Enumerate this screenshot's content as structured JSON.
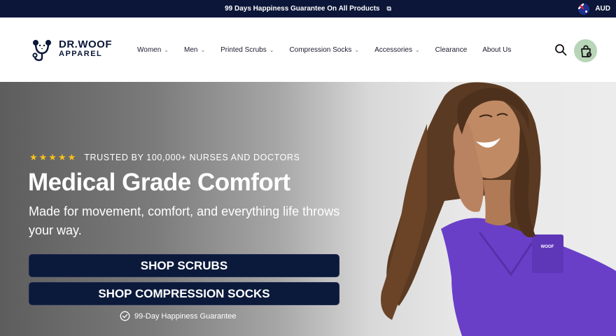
{
  "announcement": {
    "text": "99 Days Happiness Guarantee On All Products",
    "external_icon": "external-link-icon",
    "currency": "AUD",
    "flag_icon": "australia-flag-icon"
  },
  "header": {
    "logo": {
      "line1": "DR.WOOF",
      "line2": "APPAREL",
      "icon": "dog-stethoscope-logo-icon"
    },
    "nav": [
      {
        "label": "Women",
        "dropdown": true
      },
      {
        "label": "Men",
        "dropdown": true
      },
      {
        "label": "Printed Scrubs",
        "dropdown": true
      },
      {
        "label": "Compression Socks",
        "dropdown": true
      },
      {
        "label": "Accessories",
        "dropdown": true
      },
      {
        "label": "Clearance",
        "dropdown": false
      },
      {
        "label": "About Us",
        "dropdown": false
      }
    ],
    "search_icon": "search-icon",
    "cart": {
      "icon": "shopping-bag-icon",
      "count": "0",
      "background": "#b8d5b8"
    }
  },
  "hero": {
    "stars": "★★★★★",
    "rating_text": "TRUSTED BY 100,000+ NURSES AND DOCTORS",
    "headline": "Medical Grade Comfort",
    "subhead": "Made for movement, comfort, and everything life throws your way.",
    "button_scrubs": "SHOP SCRUBS",
    "button_socks": "SHOP COMPRESSION SOCKS",
    "guarantee": "99-Day Happiness Guarantee",
    "guarantee_icon": "check-badge-icon",
    "scrub_label": "WOOF"
  },
  "colors": {
    "navy": "#0b1638",
    "button": "#0b1a3b",
    "star": "#f6c21a",
    "scrub_purple": "#6a3fc8"
  }
}
